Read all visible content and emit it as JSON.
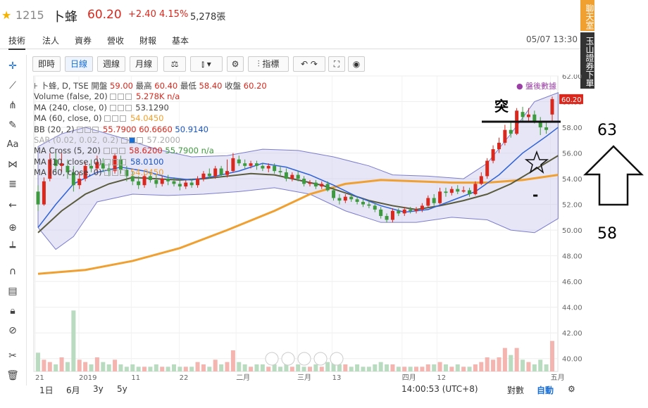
{
  "header": {
    "stock_id": "1215",
    "stock_name": "卜蜂",
    "price": "60.20",
    "change": "+2.40",
    "change_pct": "4.15%",
    "volume": "5,278張"
  },
  "nav": {
    "tabs": [
      "技術",
      "法人",
      "資券",
      "營收",
      "財報",
      "基本"
    ],
    "timestamp": "05/07 13:30"
  },
  "side_buttons": [
    "聊天室",
    "玉山證券下單"
  ],
  "toolbar": {
    "buttons": [
      "即時",
      "日線",
      "週線",
      "月線",
      "指標"
    ],
    "active": "日線"
  },
  "legend": {
    "title": "卜蜂, D, TSE",
    "ohlc": {
      "open_label": "開盤",
      "open": "59.00",
      "high_label": "最高",
      "high": "60.40",
      "low_label": "最低",
      "low": "58.40",
      "close_label": "收盤",
      "close": "60.20"
    },
    "rows": [
      {
        "label": "Volume (false, 20)",
        "values": [
          "5.278K n/a"
        ]
      },
      {
        "label": "MA (240, close, 0)",
        "values": [
          "53.1290"
        ]
      },
      {
        "label": "MA (60, close, 0)",
        "values": [
          "54.0450"
        ]
      },
      {
        "label": "BB (20, 2)",
        "values": [
          "55.7900",
          "60.6660",
          "50.9140"
        ]
      },
      {
        "label": "SAR (0.02, 0.02, 0.2)",
        "values": [
          "57.2000"
        ]
      },
      {
        "label": "MA Cross (5, 20)",
        "values": [
          "58.6200",
          "55.7900 n/a"
        ]
      },
      {
        "label": "MA (10, close, 0)",
        "values": [
          "58.0100"
        ]
      },
      {
        "label": "MA (60, close, 0)",
        "values": [
          "54.0450"
        ]
      }
    ],
    "after_hours": "盤後數據"
  },
  "bottom": {
    "ranges": [
      "1日",
      "6月",
      "3y",
      "5y"
    ],
    "time": "14:00:53 (UTC+8)",
    "log_label": "對數",
    "auto_label": "自動"
  },
  "annotations": {
    "breakout": "突",
    "target_high": "63",
    "target_low": "58",
    "dash": "-"
  },
  "colors": {
    "up": "#d9281d",
    "down": "#3e9a3e",
    "bb_fill": "#c8c8ee",
    "ma240": "#f0a030",
    "ma10": "#2f62d8",
    "ma60": "#5a5a3c"
  },
  "chart_data": {
    "type": "line",
    "ylim": [
      39,
      62
    ],
    "yticks": [
      "62.00",
      "60.00",
      "58.00",
      "56.00",
      "54.00",
      "52.00",
      "50.00",
      "48.00",
      "46.00",
      "44.00",
      "42.00",
      "40.00"
    ],
    "xticks": [
      "21",
      "2019",
      "11",
      "22",
      "二月",
      "三月",
      "13",
      "四月",
      "12",
      "五月"
    ],
    "last_price_label": "60.20",
    "candles": [
      [
        53,
        52,
        53.5,
        51.5
      ],
      [
        52,
        53.8,
        54.1,
        51.9
      ],
      [
        54,
        55.5,
        56,
        53.8
      ],
      [
        55.5,
        55,
        56.2,
        54.5
      ],
      [
        55,
        55.2,
        56,
        54.5
      ],
      [
        55,
        54.5,
        55.5,
        54
      ],
      [
        54.5,
        53.5,
        55,
        53
      ],
      [
        53.5,
        54,
        54.5,
        53.2
      ],
      [
        54,
        55,
        55.3,
        53.8
      ],
      [
        55,
        54.8,
        55.5,
        54.5
      ],
      [
        54.8,
        55.3,
        55.8,
        54.5
      ],
      [
        55.2,
        54.8,
        55.6,
        54.5
      ],
      [
        54.8,
        54.6,
        55.2,
        54.2
      ],
      [
        54.6,
        55.8,
        56,
        54.4
      ],
      [
        55.5,
        54.7,
        55.8,
        54.4
      ],
      [
        54.7,
        54.2,
        55,
        53.8
      ],
      [
        54.2,
        53.8,
        54.6,
        53.5
      ],
      [
        53.8,
        53.5,
        54.2,
        53.2
      ],
      [
        53.5,
        54.2,
        54.4,
        53.3
      ],
      [
        54.2,
        53.9,
        54.5,
        53.7
      ],
      [
        53.9,
        53.6,
        54.3,
        53.3
      ],
      [
        53.6,
        54,
        54.2,
        53.4
      ],
      [
        54,
        53.8,
        54.3,
        53.5
      ],
      [
        53.8,
        53.6,
        54.1,
        53.4
      ],
      [
        53.6,
        53.4,
        54,
        53.1
      ],
      [
        53.4,
        53.7,
        53.9,
        53.2
      ],
      [
        53.7,
        53.5,
        54,
        53.3
      ],
      [
        53.5,
        54,
        54.2,
        53.3
      ],
      [
        54,
        54.4,
        54.6,
        53.8
      ],
      [
        54.4,
        54.2,
        54.8,
        54
      ],
      [
        54.2,
        54.8,
        55,
        54
      ],
      [
        54.8,
        54.3,
        55,
        54.1
      ],
      [
        54.3,
        54.6,
        55.5,
        54.1
      ],
      [
        54.6,
        55.6,
        56,
        54.5
      ],
      [
        55.5,
        55.2,
        55.8,
        55
      ],
      [
        55.2,
        55,
        55.5,
        54.8
      ],
      [
        55,
        55.2,
        55.4,
        54.8
      ],
      [
        55.2,
        55,
        55.4,
        54.7
      ],
      [
        55,
        54.8,
        55.2,
        54.6
      ],
      [
        54.8,
        55,
        55.2,
        54.5
      ],
      [
        55,
        54.6,
        55.2,
        54.4
      ],
      [
        54.6,
        54.5,
        55,
        54.2
      ],
      [
        54.5,
        54,
        54.8,
        53.8
      ],
      [
        54,
        54.3,
        54.5,
        53.8
      ],
      [
        54.3,
        54,
        54.6,
        53.8
      ],
      [
        54,
        53.6,
        54.2,
        53.4
      ],
      [
        53.6,
        53.7,
        53.9,
        53.4
      ],
      [
        53.7,
        53.4,
        53.9,
        53.2
      ],
      [
        53.4,
        53.6,
        53.8,
        53.2
      ],
      [
        53.6,
        53.1,
        53.8,
        53
      ],
      [
        53.1,
        52.5,
        53.3,
        52.3
      ],
      [
        52.5,
        52.3,
        52.8,
        52
      ],
      [
        52.3,
        52.6,
        52.8,
        52.1
      ],
      [
        52.6,
        52.4,
        52.8,
        52.2
      ],
      [
        52.4,
        52.2,
        52.6,
        52
      ],
      [
        52.2,
        52,
        52.4,
        51.8
      ],
      [
        52,
        51.9,
        52.3,
        51.7
      ],
      [
        51.9,
        51.6,
        52.1,
        51.4
      ],
      [
        51.6,
        51.1,
        51.8,
        50.9
      ],
      [
        51.1,
        50.8,
        51.3,
        50.6
      ],
      [
        50.8,
        51.5,
        51.7,
        50.6
      ],
      [
        51.5,
        51.3,
        51.7,
        51.1
      ],
      [
        51.3,
        51.6,
        51.8,
        51.1
      ],
      [
        51.6,
        51.5,
        51.8,
        51.3
      ],
      [
        51.5,
        51.6,
        51.8,
        51.3
      ],
      [
        51.6,
        51.9,
        52.1,
        51.4
      ],
      [
        51.9,
        52.5,
        52.7,
        51.8
      ],
      [
        52.5,
        52.1,
        52.8,
        51.9
      ],
      [
        52.1,
        53,
        53.3,
        52
      ],
      [
        53,
        52.9,
        53.3,
        52.6
      ],
      [
        52.9,
        53.2,
        53.4,
        52.7
      ],
      [
        53.2,
        53,
        53.5,
        52.8
      ],
      [
        53,
        53.1,
        53.4,
        52.9
      ],
      [
        53.1,
        52.8,
        53.3,
        52.6
      ],
      [
        52.8,
        53.6,
        53.8,
        52.7
      ],
      [
        53.6,
        54.2,
        54.5,
        53.5
      ],
      [
        54.2,
        55.4,
        55.6,
        54
      ],
      [
        55.4,
        56.3,
        56.6,
        55.2
      ],
      [
        56.3,
        56.8,
        57.2,
        56
      ],
      [
        56.8,
        57.8,
        58.2,
        56.6
      ],
      [
        57.8,
        57.5,
        58.4,
        57.2
      ],
      [
        57.5,
        59.3,
        59.5,
        57.4
      ],
      [
        59.2,
        58.8,
        59.6,
        58.4
      ],
      [
        58.8,
        59,
        59.5,
        58.5
      ],
      [
        59,
        58.5,
        59.3,
        58.3
      ],
      [
        58.5,
        58,
        58.8,
        57.4
      ],
      [
        58,
        57.8,
        58.4,
        57.5
      ],
      [
        59,
        60.2,
        60.4,
        58.4
      ]
    ],
    "bb_upper": [
      [
        0,
        56.5
      ],
      [
        4,
        57.5
      ],
      [
        8,
        58
      ],
      [
        14,
        57.2
      ],
      [
        20,
        56.3
      ],
      [
        26,
        55.7
      ],
      [
        32,
        55.8
      ],
      [
        38,
        56.3
      ],
      [
        44,
        56.2
      ],
      [
        50,
        55.7
      ],
      [
        56,
        55
      ],
      [
        60,
        54.3
      ],
      [
        66,
        54.2
      ],
      [
        72,
        54
      ],
      [
        76,
        55.2
      ],
      [
        80,
        57.5
      ],
      [
        84,
        60
      ],
      [
        88,
        60.7
      ]
    ],
    "bb_lower": [
      [
        0,
        50.2
      ],
      [
        3,
        48.5
      ],
      [
        6,
        49.5
      ],
      [
        10,
        52.2
      ],
      [
        16,
        52.8
      ],
      [
        22,
        52.7
      ],
      [
        28,
        52.8
      ],
      [
        34,
        53
      ],
      [
        40,
        53.3
      ],
      [
        46,
        52.8
      ],
      [
        52,
        51.5
      ],
      [
        58,
        50.6
      ],
      [
        64,
        50.6
      ],
      [
        70,
        51
      ],
      [
        76,
        50.8
      ],
      [
        80,
        50
      ],
      [
        84,
        49.8
      ],
      [
        88,
        50.9
      ]
    ],
    "ma10": [
      [
        0,
        50.2
      ],
      [
        3,
        52
      ],
      [
        6,
        53.6
      ],
      [
        10,
        54.5
      ],
      [
        14,
        54.9
      ],
      [
        18,
        54.6
      ],
      [
        22,
        54.1
      ],
      [
        26,
        53.9
      ],
      [
        30,
        54.2
      ],
      [
        34,
        54.6
      ],
      [
        38,
        55.2
      ],
      [
        42,
        54.9
      ],
      [
        46,
        54.3
      ],
      [
        50,
        53.5
      ],
      [
        54,
        52.6
      ],
      [
        58,
        51.9
      ],
      [
        62,
        51.4
      ],
      [
        66,
        51.6
      ],
      [
        70,
        52.3
      ],
      [
        74,
        53
      ],
      [
        78,
        54.3
      ],
      [
        82,
        56
      ],
      [
        86,
        57.3
      ],
      [
        88,
        58
      ]
    ],
    "ma60": [
      [
        0,
        49.8
      ],
      [
        4,
        51.5
      ],
      [
        8,
        52.8
      ],
      [
        12,
        53.6
      ],
      [
        16,
        54.1
      ],
      [
        20,
        54
      ],
      [
        24,
        53.9
      ],
      [
        28,
        54
      ],
      [
        32,
        54.2
      ],
      [
        36,
        54.4
      ],
      [
        40,
        54.3
      ],
      [
        44,
        53.9
      ],
      [
        48,
        53.5
      ],
      [
        52,
        52.9
      ],
      [
        56,
        52.3
      ],
      [
        60,
        51.9
      ],
      [
        64,
        51.6
      ],
      [
        68,
        51.9
      ],
      [
        72,
        52.3
      ],
      [
        76,
        52.8
      ],
      [
        80,
        53.6
      ],
      [
        84,
        54.7
      ],
      [
        88,
        55.8
      ]
    ],
    "ma240": [
      [
        0,
        46.6
      ],
      [
        8,
        46.9
      ],
      [
        16,
        47.6
      ],
      [
        24,
        48.6
      ],
      [
        32,
        50
      ],
      [
        40,
        51.5
      ],
      [
        46,
        52.8
      ],
      [
        52,
        53.6
      ],
      [
        58,
        53.9
      ],
      [
        64,
        53.8
      ],
      [
        70,
        53.7
      ],
      [
        76,
        53.7
      ],
      [
        82,
        53.9
      ],
      [
        88,
        54.3
      ]
    ],
    "volumes": [
      0.8,
      0.5,
      0.4,
      0.3,
      0.6,
      0.4,
      2.6,
      0.5,
      0.4,
      0.3,
      0.6,
      0.4,
      0.3,
      0.5,
      0.3,
      0.2,
      0.3,
      0.2,
      0.2,
      0.2,
      0.3,
      0.2,
      0.2,
      0.3,
      0.2,
      0.2,
      0.2,
      0.4,
      0.3,
      0.2,
      0.5,
      0.3,
      0.4,
      0.9,
      0.4,
      0.3,
      0.2,
      0.3,
      0.3,
      0.2,
      0.3,
      0.2,
      0.5,
      0.2,
      0.3,
      0.2,
      0.2,
      0.3,
      0.2,
      0.4,
      0.5,
      0.3,
      0.3,
      0.2,
      0.3,
      0.2,
      0.2,
      0.3,
      0.4,
      0.3,
      0.3,
      0.2,
      0.2,
      0.2,
      0.2,
      0.2,
      0.3,
      0.3,
      0.4,
      0.3,
      0.2,
      0.3,
      0.2,
      0.2,
      0.3,
      0.4,
      0.6,
      0.5,
      0.6,
      1.0,
      0.7,
      1.0,
      0.5,
      0.4,
      0.3,
      0.5,
      0.3,
      1.3
    ]
  }
}
